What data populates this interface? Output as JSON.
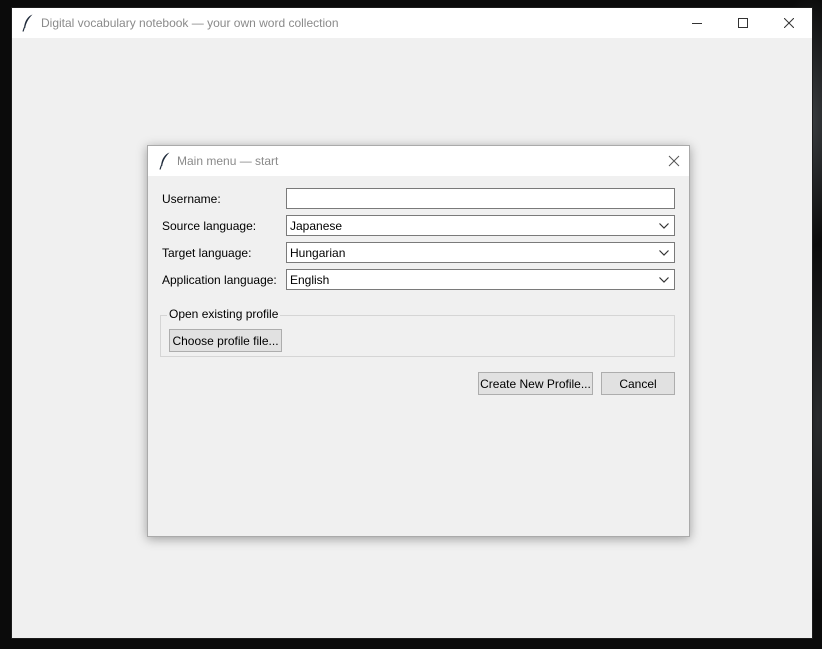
{
  "main_window": {
    "title": "Digital vocabulary notebook — your own word collection"
  },
  "dialog": {
    "title": "Main menu — start",
    "username": {
      "label": "Username:",
      "value": ""
    },
    "source_language": {
      "label": "Source language:",
      "value": "Japanese"
    },
    "target_language": {
      "label": "Target language:",
      "value": "Hungarian"
    },
    "application_language": {
      "label": "Application language:",
      "value": "English"
    },
    "open_profile": {
      "legend": "Open existing profile",
      "choose_button": "Choose profile file..."
    },
    "create_button": "Create New Profile...",
    "cancel_button": "Cancel"
  },
  "icons": {
    "app": "feather-icon",
    "minimize": "minimize-icon",
    "maximize": "maximize-icon",
    "close": "close-icon",
    "dropdown": "chevron-down-icon"
  },
  "colors": {
    "window_bg": "#f0f0f0",
    "titlebar_bg": "#ffffff",
    "title_text": "#8a8a8a",
    "button_bg": "#e1e1e1",
    "button_border": "#adadad"
  }
}
